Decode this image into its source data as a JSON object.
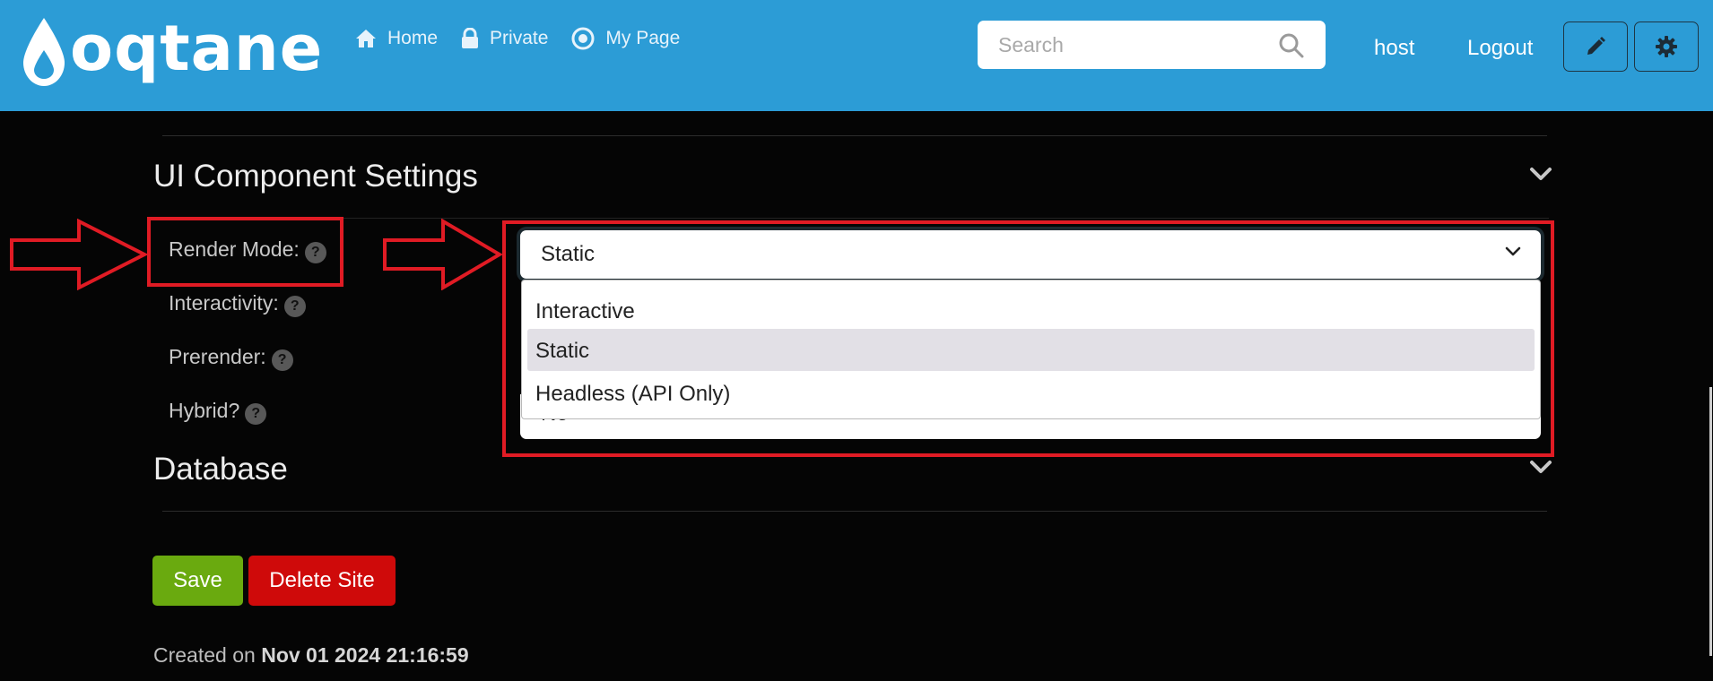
{
  "brand": {
    "name": "oqtane"
  },
  "nav": {
    "items": [
      {
        "label": "Home",
        "icon": "home-icon"
      },
      {
        "label": "Private",
        "icon": "lock-icon"
      },
      {
        "label": "My Page",
        "icon": "target-icon"
      }
    ]
  },
  "search": {
    "placeholder": "Search",
    "value": ""
  },
  "user": {
    "username": "host",
    "logout": "Logout"
  },
  "toolbar": {
    "edit_icon": "pencil-icon",
    "settings_icon": "gear-icon"
  },
  "sections": {
    "ui_component": {
      "title": "UI Component Settings"
    },
    "database": {
      "title": "Database"
    }
  },
  "fields": {
    "render_mode": "Render Mode:",
    "interactivity": "Interactivity:",
    "prerender": "Prerender:",
    "hybrid": "Hybrid?"
  },
  "render_mode_select": {
    "value": "Static",
    "options": [
      "Interactive",
      "Static",
      "Headless (API Only)"
    ]
  },
  "hybrid_select": {
    "partial_value": "No"
  },
  "buttons": {
    "save": "Save",
    "delete": "Delete Site"
  },
  "created": {
    "prefix": "Created on",
    "date": "Nov 01 2024 21:16:59"
  },
  "colors": {
    "navbar": "#2c9cd6",
    "save": "#6aaa0f",
    "delete": "#cf0a0a",
    "annotation": "#e01b24",
    "background": "#050505"
  }
}
